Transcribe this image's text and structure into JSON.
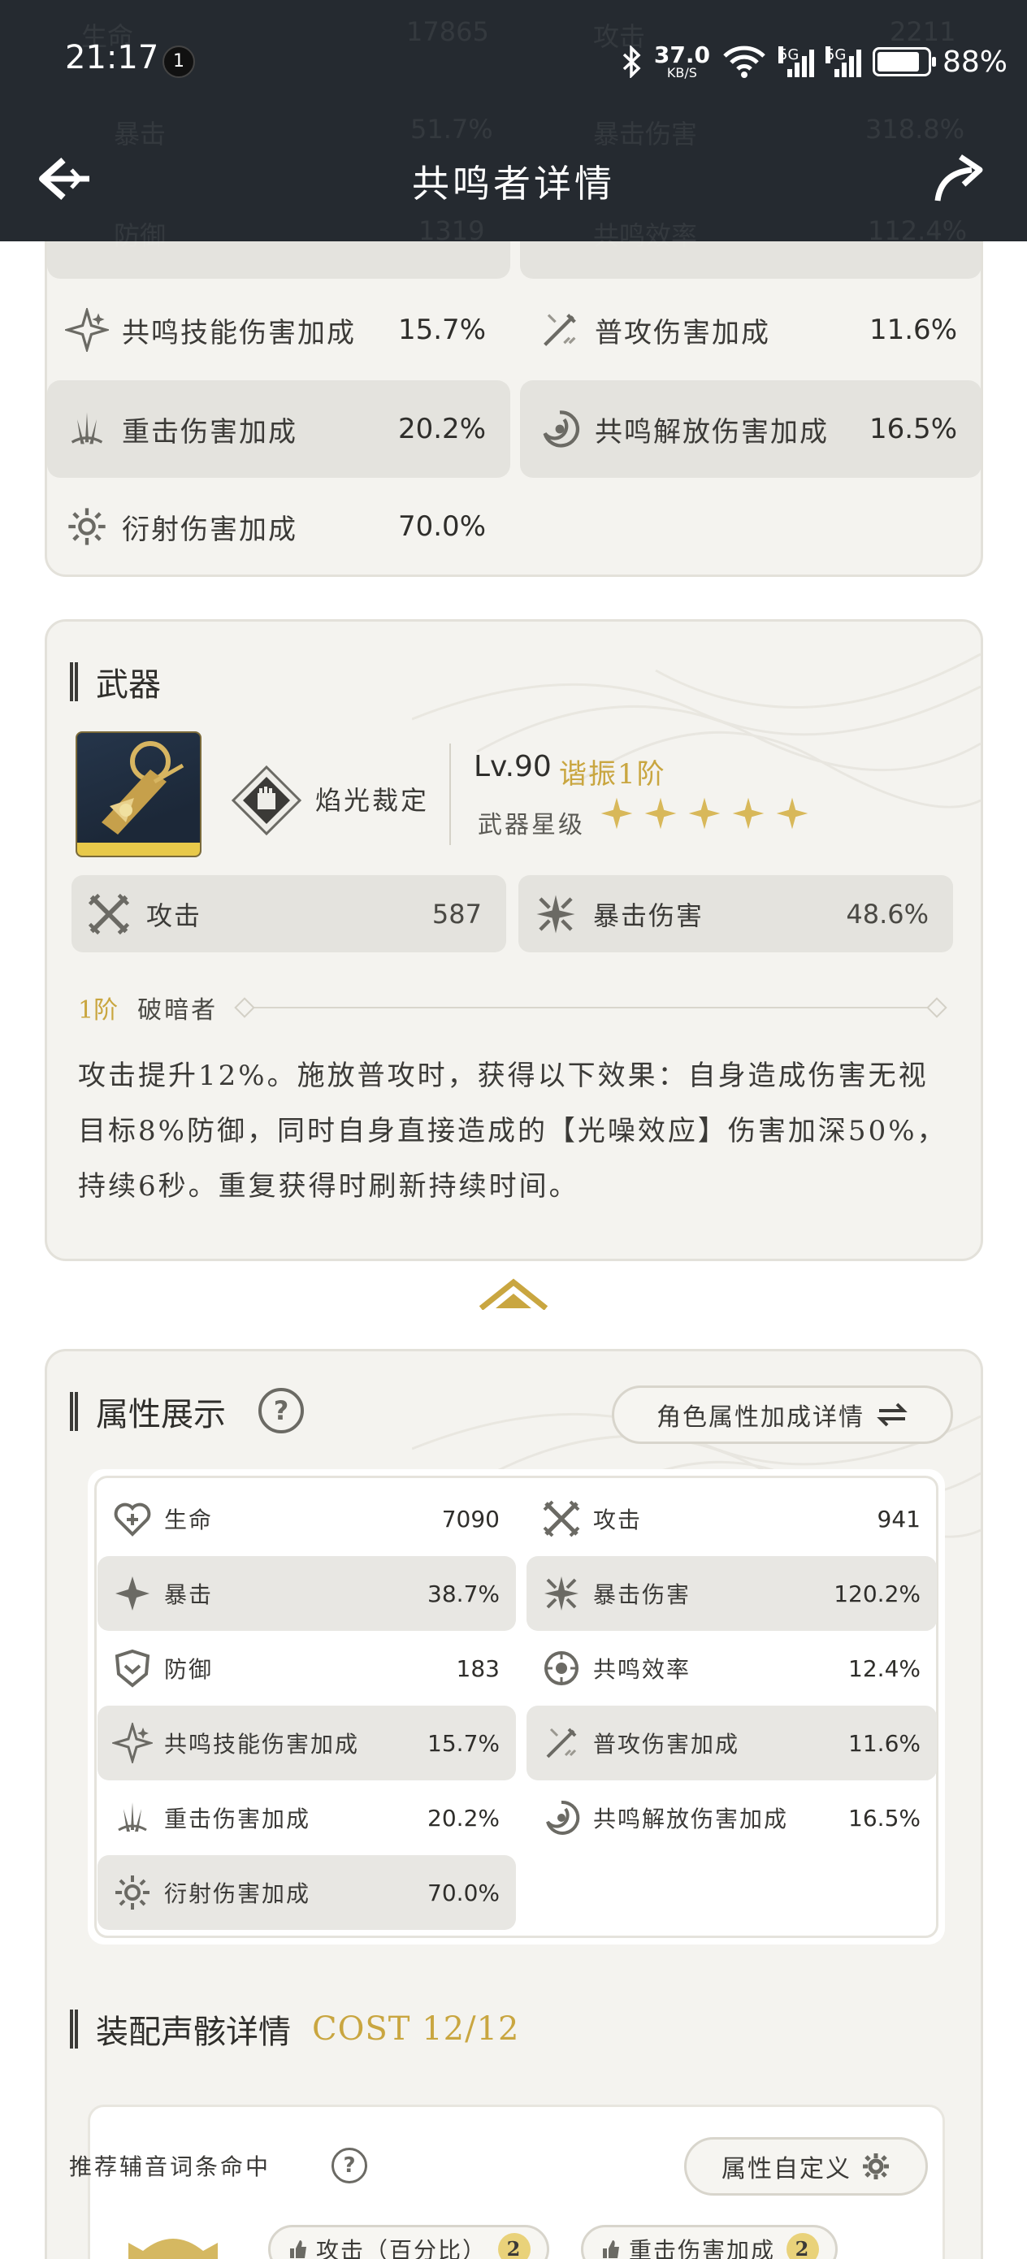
{
  "status_bar": {
    "time": "21:17",
    "notification_count": "1",
    "net_speed_value": "37.0",
    "net_speed_unit": "KB/S",
    "signal_1": "5G",
    "signal_2": "5G",
    "battery": "88%"
  },
  "header": {
    "title": "共鸣者详情"
  },
  "header_ghost_text": {
    "row1_left_label": "生命",
    "row1_left_value": "17865",
    "row1_right_label": "攻击",
    "row1_right_value": "2211",
    "row2_left_label": "暴击",
    "row2_left_value": "51.7%",
    "row2_right_label": "暴击伤害",
    "row2_right_value": "318.8%",
    "row3_left_label": "防御",
    "row3_left_value": "1319",
    "row3_right_label": "共鸣效率",
    "row3_right_value": "112.4%"
  },
  "total_stats": [
    {
      "label": "共鸣技能伤害加成",
      "value": "15.7%",
      "icon": "resonance-skill-icon"
    },
    {
      "label": "普攻伤害加成",
      "value": "11.6%",
      "icon": "basic-attack-icon"
    },
    {
      "label": "重击伤害加成",
      "value": "20.2%",
      "icon": "heavy-attack-icon"
    },
    {
      "label": "共鸣解放伤害加成",
      "value": "16.5%",
      "icon": "resonance-liberation-icon"
    },
    {
      "label": "衍射伤害加成",
      "value": "70.0%",
      "icon": "spectro-icon"
    }
  ],
  "weapon": {
    "section_title": "武器",
    "name": "焰光裁定",
    "level": "Lv.90",
    "rank": "谐振1阶",
    "star_label": "武器星级",
    "stars": 5,
    "stats": [
      {
        "label": "攻击",
        "value": "587",
        "icon": "attack-icon"
      },
      {
        "label": "暴击伤害",
        "value": "48.6%",
        "icon": "crit-damage-icon"
      }
    ],
    "passive_rank": "1阶",
    "passive_name": "破暗者",
    "passive_desc": "攻击提升12%。施放普攻时，获得以下效果：自身造成伤害无视目标8%防御，同时自身直接造成的【光噪效应】伤害加深50%，持续6秒。重复获得时刷新持续时间。"
  },
  "attributes": {
    "section_title": "属性展示",
    "help": "?",
    "bonus_button": "角色属性加成详情",
    "rows": [
      {
        "label": "生命",
        "value": "7090",
        "icon": "hp-icon"
      },
      {
        "label": "攻击",
        "value": "941",
        "icon": "attack-icon"
      },
      {
        "label": "暴击",
        "value": "38.7%",
        "icon": "crit-icon"
      },
      {
        "label": "暴击伤害",
        "value": "120.2%",
        "icon": "crit-damage-icon"
      },
      {
        "label": "防御",
        "value": "183",
        "icon": "defense-icon"
      },
      {
        "label": "共鸣效率",
        "value": "12.4%",
        "icon": "energy-regen-icon"
      },
      {
        "label": "共鸣技能伤害加成",
        "value": "15.7%",
        "icon": "resonance-skill-icon"
      },
      {
        "label": "普攻伤害加成",
        "value": "11.6%",
        "icon": "basic-attack-icon"
      },
      {
        "label": "重击伤害加成",
        "value": "20.2%",
        "icon": "heavy-attack-icon"
      },
      {
        "label": "共鸣解放伤害加成",
        "value": "16.5%",
        "icon": "resonance-liberation-icon"
      },
      {
        "label": "衍射伤害加成",
        "value": "70.0%",
        "icon": "spectro-icon"
      }
    ]
  },
  "echo": {
    "section_title": "装配声骸详情",
    "cost": "COST 12/12",
    "recommend_label": "推荐辅音词条命中",
    "help": "?",
    "custom_button": "属性自定义",
    "tags": [
      {
        "label": "攻击（百分比）",
        "count": "2"
      },
      {
        "label": "重击伤害加成",
        "count": "2"
      }
    ]
  },
  "colors": {
    "header_bg": "#252a30",
    "card_bg": "#f4f3ef",
    "accent_gold": "#c9a640",
    "shade_row": "#e4e3de"
  }
}
